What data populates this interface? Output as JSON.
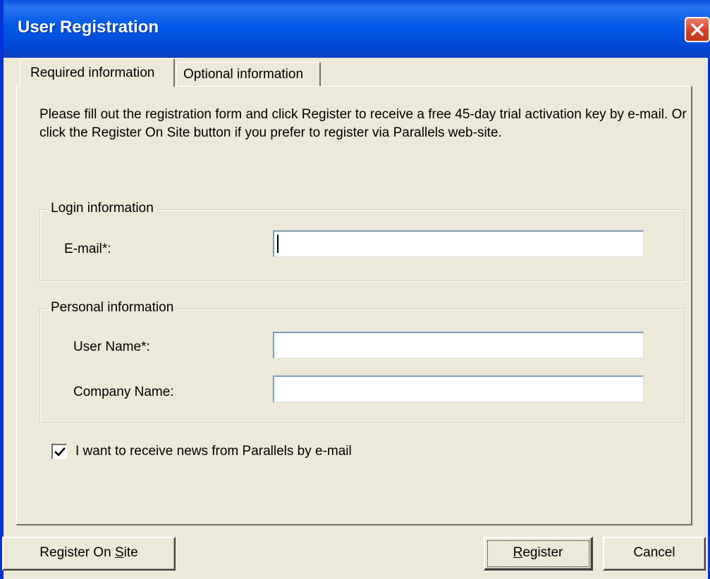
{
  "window": {
    "title": "User Registration"
  },
  "tabs": [
    {
      "label": "Required information",
      "active": true
    },
    {
      "label": "Optional information",
      "active": false
    }
  ],
  "intro_text": "Please fill out the registration form and click Register to receive a free 45-day trial activation key by e-mail. Or click the Register On Site button if you prefer to register via Parallels web-site.",
  "login_group": {
    "legend": "Login information",
    "email_label": "E-mail*:",
    "email_value": ""
  },
  "personal_group": {
    "legend": "Personal information",
    "username_label": "User Name*:",
    "username_value": "",
    "company_label": "Company Name:",
    "company_value": ""
  },
  "newsletter": {
    "label": "I want to receive news from Parallels by e-mail",
    "checked": true
  },
  "buttons": {
    "register_on_site_pre": "Register On ",
    "register_on_site_accel": "S",
    "register_on_site_post": "ite",
    "register_accel": "R",
    "register_post": "egister",
    "cancel": "Cancel"
  },
  "colors": {
    "titlebar": "#0058e6",
    "dialog_bg": "#ece9d8",
    "close_button": "#d7432a"
  },
  "icons": {
    "close": "close-icon",
    "check": "checkmark-icon"
  }
}
